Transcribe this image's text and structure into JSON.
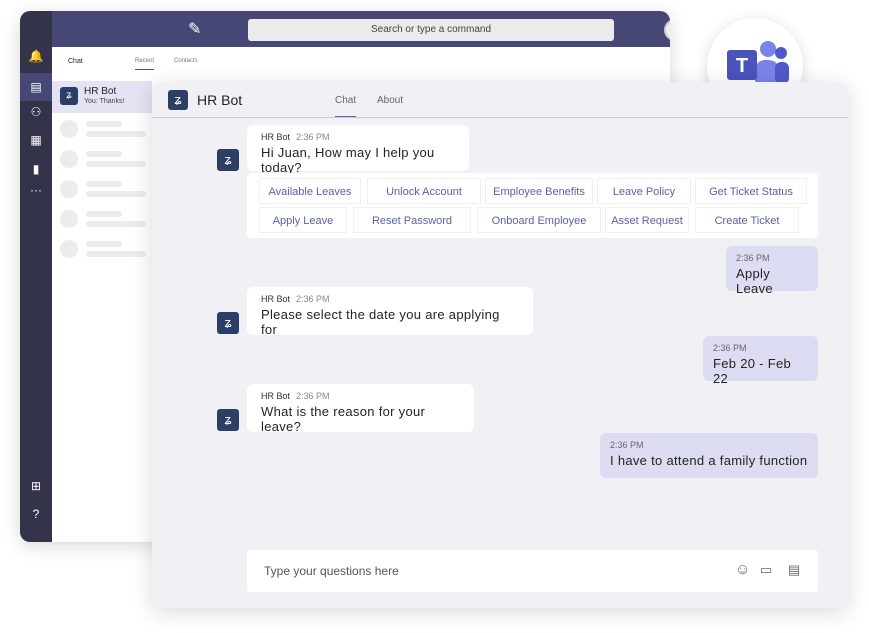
{
  "back_window": {
    "search_placeholder": "Search or type a command",
    "tabs": {
      "chat": "Chat",
      "recent": "Recent",
      "contacts": "Contacts"
    },
    "selected_chat": {
      "name": "HR Bot",
      "preview": "You: Thanks!"
    }
  },
  "header": {
    "title": "HR Bot",
    "tabs": [
      "Chat",
      "About"
    ]
  },
  "messages": [
    {
      "sender": "HR Bot",
      "time": "2:36 PM",
      "text": "Hi Juan, How may I help you today?"
    },
    {
      "sender": "",
      "time": "2:36 PM",
      "text": "Apply Leave"
    },
    {
      "sender": "HR Bot",
      "time": "2:36 PM",
      "text": "Please select the date you are applying for"
    },
    {
      "sender": "",
      "time": "2:36 PM",
      "text": "Feb 20 - Feb 22"
    },
    {
      "sender": "HR Bot",
      "time": "2:36 PM",
      "text": "What is the reason for your leave?"
    },
    {
      "sender": "",
      "time": "2:36 PM",
      "text": "I have to attend a family function"
    }
  ],
  "quick_actions": [
    "Available Leaves",
    "Unlock Account",
    "Employee Benefits",
    "Leave Policy",
    "Get Ticket Status",
    "Apply Leave",
    "Reset Password",
    "Onboard Employee",
    "Asset Request",
    "Create Ticket"
  ],
  "composer": {
    "placeholder": "Type your questions here"
  },
  "colors": {
    "accent": "#464775",
    "rail": "#33344a",
    "bot_avatar": "#2b3f66",
    "user_bubble": "#dcdcf2",
    "action_text": "#5b5fa7"
  }
}
